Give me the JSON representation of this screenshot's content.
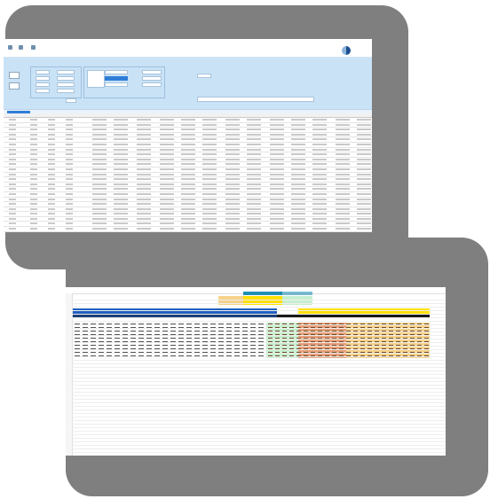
{
  "app": {
    "title": "",
    "ribbon_buttons": [
      {
        "label": "",
        "icon": "save-icon"
      },
      {
        "label": "",
        "icon": "export-icon"
      },
      {
        "label": "",
        "icon": "settings-icon"
      }
    ],
    "brand_logo_text": "",
    "colors": {
      "frame": "#7f7f7f",
      "panel": "#c9e2f6",
      "accent": "#2f7ed8",
      "brand": "#1c4f8f"
    }
  },
  "sheet": {
    "colors": {
      "title_band": "#1f5fbf",
      "teal_header": "#1f8fb5",
      "yellow_header": "#ffe000",
      "green_cells": "#c6efce",
      "red_cells": "#e8a07a",
      "orange_cells": "#f7d28a"
    }
  }
}
